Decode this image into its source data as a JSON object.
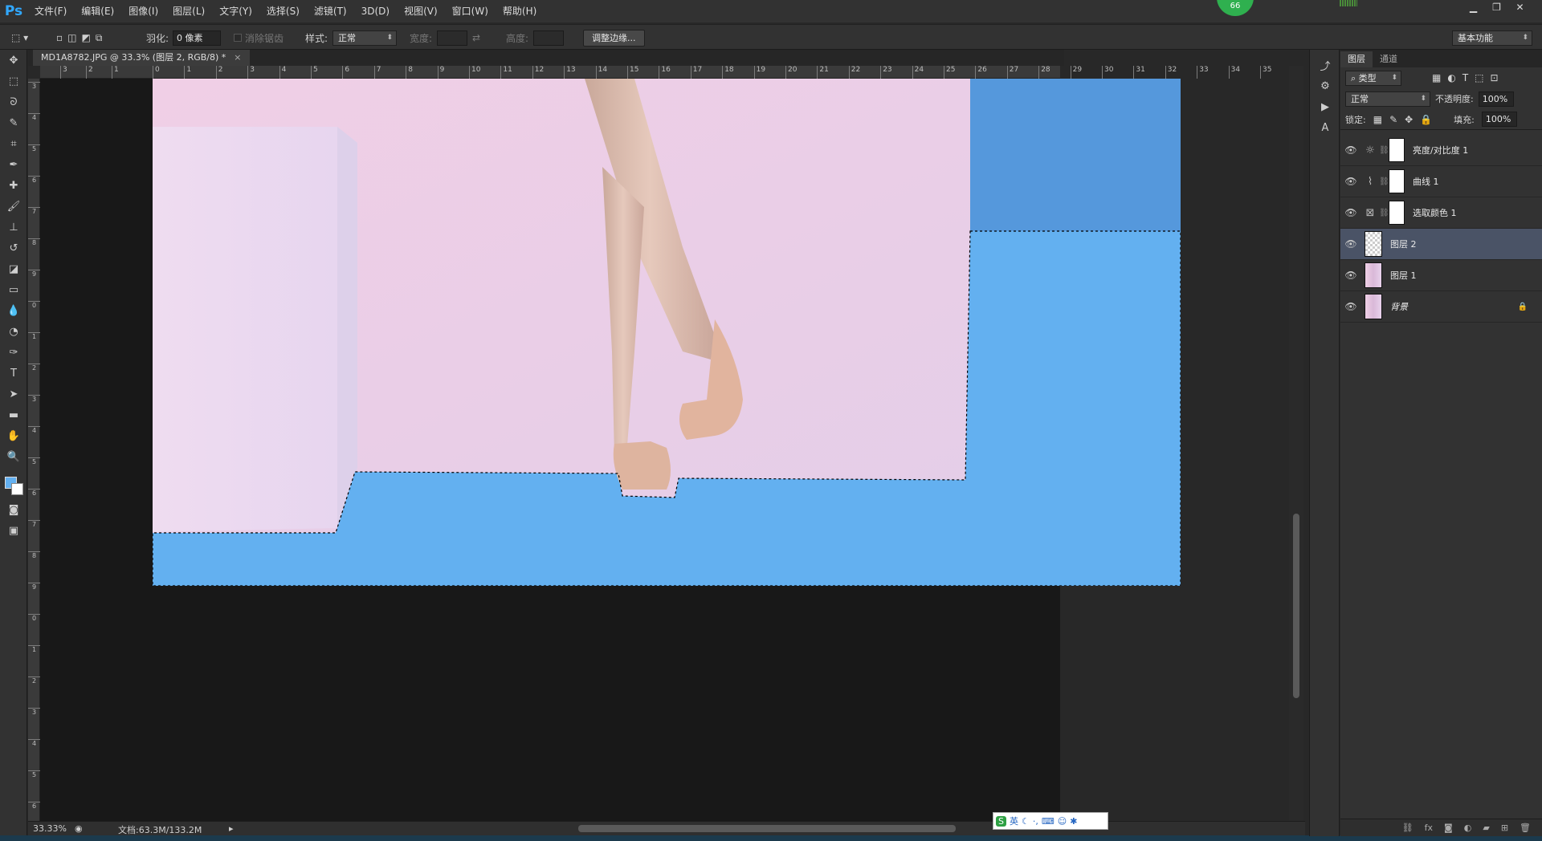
{
  "app": {
    "logo": "Ps",
    "badge": "66"
  },
  "menu": [
    "文件(F)",
    "编辑(E)",
    "图像(I)",
    "图层(L)",
    "文字(Y)",
    "选择(S)",
    "滤镜(T)",
    "3D(D)",
    "视图(V)",
    "窗口(W)",
    "帮助(H)"
  ],
  "options": {
    "feather_label": "羽化:",
    "feather_value": "0 像素",
    "antialias_label": "消除锯齿",
    "style_label": "样式:",
    "style_value": "正常",
    "width_label": "宽度:",
    "height_label": "高度:",
    "refine_edge": "调整边缘...",
    "workspace": "基本功能"
  },
  "document": {
    "tab_title": "MD1A8782.JPG @ 33.3% (图层 2, RGB/8) *",
    "close": "×"
  },
  "ruler": {
    "h": [
      "0",
      "1",
      "2",
      "3",
      "4",
      "5",
      "6",
      "7",
      "8",
      "9",
      "10",
      "11",
      "12",
      "13",
      "14",
      "15",
      "16",
      "17",
      "18",
      "19",
      "20",
      "21",
      "22",
      "23",
      "24",
      "25",
      "26",
      "27",
      "28",
      "29",
      "30",
      "31",
      "32",
      "33",
      "34",
      "35"
    ],
    "h_pre": [
      "3",
      "2",
      "1"
    ],
    "v": [
      "3",
      "4",
      "5",
      "6",
      "7",
      "8",
      "9",
      "0",
      "1",
      "2",
      "3",
      "4",
      "5",
      "6",
      "7",
      "8",
      "9",
      "0",
      "1",
      "2",
      "3",
      "4",
      "5",
      "6"
    ]
  },
  "status": {
    "zoom": "33.33%",
    "doc": "文档:63.3M/133.2M"
  },
  "ime": {
    "lang": "英"
  },
  "layers_panel": {
    "tabs": [
      "图层",
      "通道"
    ],
    "filter": "类型",
    "blend_mode": "正常",
    "opacity_label": "不透明度:",
    "opacity_value": "100%",
    "lock_label": "锁定:",
    "fill_label": "填充:",
    "fill_value": "100%",
    "layers": [
      {
        "name": "亮度/对比度 1"
      },
      {
        "name": "曲线 1"
      },
      {
        "name": "选取颜色 1"
      },
      {
        "name": "图层 2"
      },
      {
        "name": "图层 1"
      },
      {
        "name": "背景"
      }
    ]
  },
  "colors": {
    "selection_fill": "#63b0f0",
    "wall": "#e8d0e8",
    "sky_blue": "#5599dd",
    "accent": "#31a8ff"
  }
}
